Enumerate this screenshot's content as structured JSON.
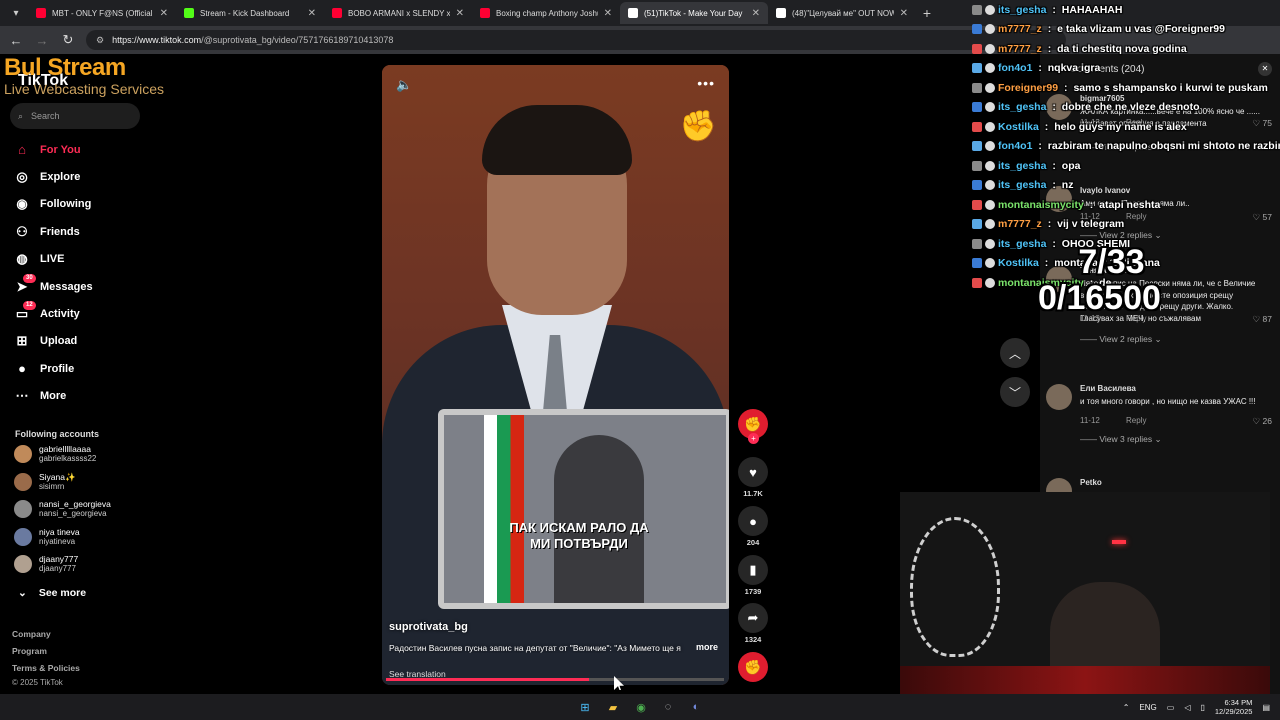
{
  "browser": {
    "tabs": [
      {
        "title": "MBT - ONLY F@NS (Official Au",
        "icon": "youtube-icon",
        "color": "#ff0033"
      },
      {
        "title": "Stream - Kick Dashboard",
        "icon": "kick-icon",
        "color": "#53fc18"
      },
      {
        "title": "BOBO ARMANI x SLENDY x PAI",
        "icon": "youtube-icon",
        "color": "#ff0033"
      },
      {
        "title": "Boxing champ Anthony Joshua",
        "icon": "youtube-icon",
        "color": "#ff0033"
      },
      {
        "title": "(51)TikTok - Make Your Day",
        "icon": "tiktok-icon",
        "color": "#ffffff"
      },
      {
        "title": "(48)\"Целувай ме\" OUT NOW #",
        "icon": "tiktok-icon",
        "color": "#ffffff"
      }
    ],
    "url_base": "https://www.tiktok.com",
    "url_path": "/@suprotivata_bg/video/7571766189710413078"
  },
  "overlay": {
    "brand": "Bul  Stream",
    "sub": "Live Webcasting Services"
  },
  "sidebar": {
    "logo": "TikTok",
    "search_placeholder": "Search",
    "menu": [
      {
        "label": "For You",
        "icon": "home-icon",
        "glyph": "⌂",
        "badge": ""
      },
      {
        "label": "Explore",
        "icon": "compass-icon",
        "glyph": "◎",
        "badge": ""
      },
      {
        "label": "Following",
        "icon": "following-icon",
        "glyph": "◉",
        "badge": ""
      },
      {
        "label": "Friends",
        "icon": "friends-icon",
        "glyph": "⚇",
        "badge": ""
      },
      {
        "label": "LIVE",
        "icon": "live-icon",
        "glyph": "◍",
        "badge": ""
      },
      {
        "label": "Messages",
        "icon": "messages-icon",
        "glyph": "➤",
        "badge": "30"
      },
      {
        "label": "Activity",
        "icon": "activity-icon",
        "glyph": "▭",
        "badge": "12"
      },
      {
        "label": "Upload",
        "icon": "upload-icon",
        "glyph": "⊞",
        "badge": ""
      },
      {
        "label": "Profile",
        "icon": "profile-icon",
        "glyph": "●",
        "badge": ""
      },
      {
        "label": "More",
        "icon": "more-icon",
        "glyph": "⋯",
        "badge": ""
      }
    ],
    "following_header": "Following accounts",
    "following": [
      {
        "name": "gabrielllllaaaa",
        "user": "gabrielkassss22"
      },
      {
        "name": "Siyana✨",
        "user": "sisimrn"
      },
      {
        "name": "nansi_e_georgieva",
        "user": "nansi_e_georgieva"
      },
      {
        "name": "niya tineva",
        "user": "niyatineva"
      },
      {
        "name": "djaany777",
        "user": "djaany777"
      }
    ],
    "see_more": "See more",
    "footer": [
      "Company",
      "Program",
      "Terms & Policies"
    ],
    "copyright": "© 2025 TikTok"
  },
  "video": {
    "username": "suprotivata_bg",
    "description": "Радостин Василев пусна запис на депутат от \"Величие\": \"Аз Мимето ще я",
    "more": "more",
    "see_translation": "See translation",
    "laptop_caption": "ПАК ИСКАМ РАЛО ДА МИ ПОТВЪРДИ",
    "progress": 0.6
  },
  "actions": {
    "likes": "11.7K",
    "comments": "204",
    "saves": "1739",
    "shares": "1324"
  },
  "comments_panel": {
    "title": "Comments (204)",
    "items": [
      {
        "name": "bigmar7605",
        "text": "ЖАЛКА картинка......вече е на 100% ясно че ...... изиграват опозиция в парламента",
        "date": "11-13",
        "reply": "Reply",
        "likes": "75",
        "view_replies": "View 6 replies"
      },
      {
        "name": "Ivaylo Ivanov",
        "text": "Ами сега... Пеевски няма ли..",
        "date": "11-12",
        "reply": "Reply",
        "likes": "57",
        "view_replies": "View 2 replies"
      },
      {
        "name": "Таня Атанасова",
        "text": "Някой запис на Пеевски няма ли, че с Величие вече забравих ги, че сте опозиция срещу мафията, а не едни срещу други. Жалко. Гласувах за МЕЧ, но съжалявам",
        "date": "11-12",
        "reply": "Reply",
        "likes": "87",
        "view_replies": "View 2 replies"
      },
      {
        "name": "Ели Василева",
        "text": "и тоя много говори , но нищо не казва УЖАС !!!",
        "date": "11-12",
        "reply": "Reply",
        "likes": "26",
        "view_replies": "View 3 replies"
      },
      {
        "name": "Petko",
        "text": "",
        "date": "",
        "reply": "",
        "likes": "",
        "view_replies": ""
      }
    ]
  },
  "stream_chat": [
    {
      "user": "its_gesha",
      "color": "#4fc3f7",
      "msg": "HAHAAHAH"
    },
    {
      "user": "m7777_z",
      "color": "#ff9f43",
      "msg": "e taka vlizam u vas @Foreigner99"
    },
    {
      "user": "m7777_z",
      "color": "#ff9f43",
      "msg": "da ti chestitq nova godina"
    },
    {
      "user": "fon4o1",
      "color": "#4fc3f7",
      "msg": "nqkva igra"
    },
    {
      "user": "Foreigner99",
      "color": "#ff9f43",
      "msg": "samo s shampansko i kurwi te puskam"
    },
    {
      "user": "its_gesha",
      "color": "#4fc3f7",
      "msg": "dobre che ne vleze desnoto"
    },
    {
      "user": "Kostilka",
      "color": "#4fc3f7",
      "msg": "helo guys my name is alex"
    },
    {
      "user": "fon4o1",
      "color": "#4fc3f7",
      "msg": "razbiram te napulno obqsni mi shtoto ne razbiram"
    },
    {
      "user": "its_gesha",
      "color": "#4fc3f7",
      "msg": "opa"
    },
    {
      "user": "its_gesha",
      "color": "#4fc3f7",
      "msg": "nz"
    },
    {
      "user": "montanaismycity",
      "color": "#7be36b",
      "msg": "atapi neshta"
    },
    {
      "user": "m7777_z",
      "color": "#ff9f43",
      "msg": "vij v telegram"
    },
    {
      "user": "its_gesha",
      "color": "#4fc3f7",
      "msg": "OHOO SHEMI"
    },
    {
      "user": "Kostilka",
      "color": "#4fc3f7",
      "msg": "montana v 11 li stana"
    },
    {
      "user": "montanaismycity",
      "color": "#7be36b",
      "msg": "de"
    }
  ],
  "counter": {
    "a": "7/33",
    "b": "0/16500"
  },
  "taskbar": {
    "lang": "ENG",
    "time": "6:34 PM",
    "date": "12/29/2025"
  }
}
